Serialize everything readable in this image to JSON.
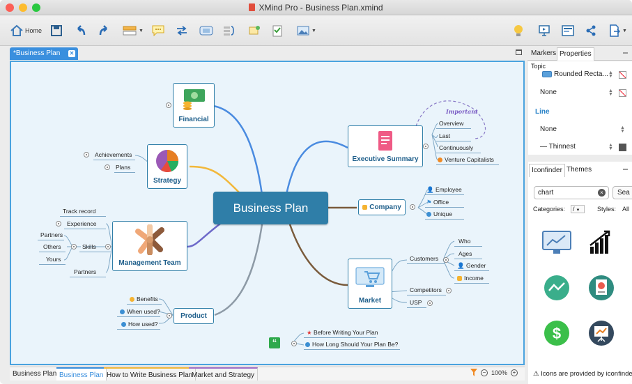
{
  "window": {
    "title": "XMind Pro - Business Plan.xmind"
  },
  "toolbar": {
    "home_label": "Home"
  },
  "doc_tab": {
    "label": "*Business Plan",
    "close": "✕"
  },
  "map": {
    "central": "Business Plan",
    "financial": {
      "label": "Financial"
    },
    "strategy": {
      "label": "Strategy",
      "subs": [
        "Achievements",
        "Plans"
      ]
    },
    "management": {
      "label": "Management Team",
      "subs": [
        "Track record",
        "Experience",
        "Skills",
        "Partners",
        "Others",
        "Yours",
        "Partners"
      ]
    },
    "product": {
      "label": "Product",
      "subs": [
        "Benefits",
        "When used?",
        "How used?"
      ]
    },
    "executive": {
      "label": "Executive Summary",
      "subs": [
        "Overview",
        "Last",
        "Continuously",
        "Venture Capitalists"
      ],
      "callout": "Important"
    },
    "company": {
      "label": "Company",
      "subs": [
        "Employee",
        "Office",
        "Unique"
      ]
    },
    "market": {
      "label": "Market",
      "subs": [
        "Customers",
        "Who",
        "Ages",
        "Gender",
        "Income",
        "Competitors",
        "USP"
      ]
    },
    "floating": {
      "subs": [
        "Before Writing Your Plan",
        "How Long Should Your Plan Be?"
      ]
    }
  },
  "sheets": [
    "Business Plan",
    "Business Plan",
    "How to Write Business Plan",
    "Market and Strategy"
  ],
  "zoom": {
    "level": "100%",
    "minus": "−",
    "plus": "+"
  },
  "props_panel": {
    "tabs": [
      "Markers",
      "Properties"
    ],
    "topic_label": "Topic",
    "shape": "Rounded Recta...",
    "fill": "None",
    "line_title": "Line",
    "line_color": "None",
    "line_width": "— Thinnest"
  },
  "icon_panel": {
    "tabs": [
      "Iconfinder",
      "Themes"
    ],
    "search_value": "chart",
    "search_button": "Sea",
    "categories_label": "Categories:",
    "categories_value": "/",
    "styles_label": "Styles:",
    "styles_value": "All",
    "footer": "Icons are provided by iconfinde"
  },
  "colors": {
    "accent": "#2f7ea8",
    "canvas": "#eaf4fb",
    "tab_blue": "#3a8fde"
  }
}
